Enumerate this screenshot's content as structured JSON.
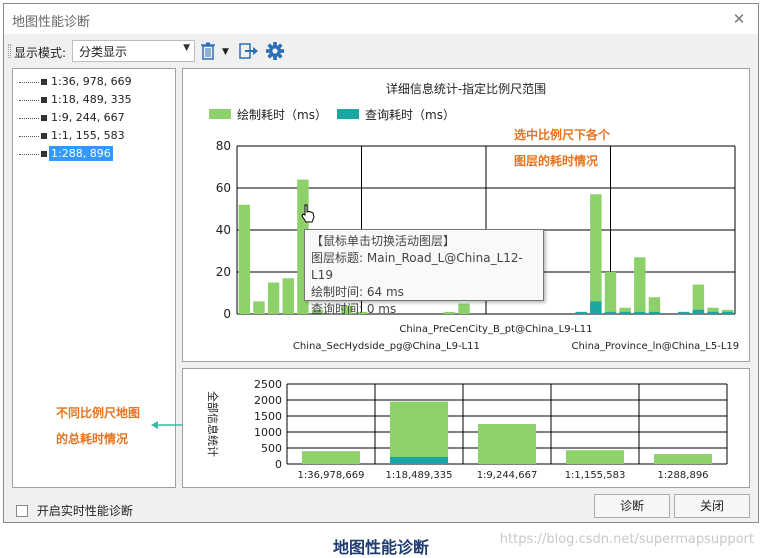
{
  "window": {
    "title": "地图性能诊断",
    "close_glyph": "✕"
  },
  "toolbar": {
    "display_mode_label": "显示模式:",
    "display_mode_value": "分类显示",
    "dropdown_glyph": "▼"
  },
  "tree": {
    "items": [
      {
        "label": "1:36, 978, 669"
      },
      {
        "label": "1:18, 489, 335"
      },
      {
        "label": "1:9, 244, 667"
      },
      {
        "label": "1:1, 155, 583"
      },
      {
        "label": "1:288, 896"
      }
    ],
    "selected_index": 4
  },
  "top_chart": {
    "title": "详细信息统计-指定比例尺范围",
    "legend": [
      {
        "name": "绘制耗时（ms）",
        "color": "#8dd16b"
      },
      {
        "name": "查询耗时（ms）",
        "color": "#1aa7a3"
      }
    ],
    "ylim": [
      0,
      80
    ],
    "yticks": [
      "80",
      "60",
      "40",
      "20",
      "0"
    ],
    "xlabels": [
      {
        "text": "China_PreCenCity_B_pt@China_L9-L11",
        "row": 1
      },
      {
        "text": "China_SecHydside_pg@China_L9-L11",
        "row": 2
      },
      {
        "text": "China_Province_ln@China_L5-L19",
        "row": 2
      }
    ]
  },
  "chart_data": [
    {
      "type": "bar",
      "title": "详细信息统计-指定比例尺范围",
      "ylim": [
        0,
        80
      ],
      "legend_position": "top-left",
      "grid": true,
      "series": [
        {
          "name": "绘制耗时（ms）",
          "values": [
            52,
            6,
            15,
            17,
            64,
            2,
            0,
            4,
            1,
            0,
            0,
            0,
            0,
            0,
            1,
            5,
            0,
            0,
            0,
            0,
            0,
            0,
            0,
            1,
            57,
            20,
            3,
            27,
            8,
            0,
            1,
            14,
            3,
            2
          ]
        },
        {
          "name": "查询耗时（ms）",
          "values": [
            0,
            0,
            0,
            0,
            0,
            0,
            0,
            0,
            0,
            0,
            0,
            0,
            0,
            0,
            0,
            0,
            0,
            0,
            0,
            0,
            0,
            0,
            0,
            1,
            6,
            1,
            1,
            1,
            1,
            0,
            1,
            2,
            1,
            1
          ]
        }
      ]
    },
    {
      "type": "bar",
      "title": "",
      "ylabel": "全部信息统计",
      "categories": [
        "1:36,978,669",
        "1:18,489,335",
        "1:9,244,667",
        "1:1,155,583",
        "1:288,896"
      ],
      "ylim": [
        0,
        2500
      ],
      "yticks": [
        "2500",
        "2000",
        "1500",
        "1000",
        "500",
        "0"
      ],
      "grid": true,
      "series": [
        {
          "name": "绘制耗时（ms）",
          "values": [
            400,
            1950,
            1250,
            430,
            310
          ]
        },
        {
          "name": "查询耗时（ms）",
          "values": [
            10,
            220,
            10,
            5,
            5
          ]
        }
      ]
    }
  ],
  "bottom_chart": {
    "ylabel": "全部信息统计",
    "yticks": [
      "2500",
      "2000",
      "1500",
      "1000",
      "500",
      "0"
    ],
    "xlabels": [
      "1:36,978,669",
      "1:18,489,335",
      "1:9,244,667",
      "1:1,155,583",
      "1:288,896"
    ]
  },
  "tooltip": {
    "heading": "【鼠标单击切换活动图层】",
    "layer_line": "图层标题: Main_Road_L@China_L12-L19",
    "draw_line": "绘制时间: 64 ms",
    "query_line": "查询时间: 0 ms"
  },
  "annotations": {
    "top_line1": "选中比例尺下各个",
    "top_line2": "图层的耗时情况",
    "left_line1": "不同比例尺地图",
    "left_line2": "的总耗时情况"
  },
  "footer": {
    "realtime_label": "开启实时性能诊断",
    "diagnose_button": "诊断",
    "close_button": "关闭"
  },
  "caption": "地图性能诊断",
  "watermark": "https://blog.csdn.net/supermapsupport",
  "colors": {
    "draw": "#8dd16b",
    "query": "#1aa7a3",
    "accent": "#e8731e",
    "selection": "#3399ff"
  }
}
